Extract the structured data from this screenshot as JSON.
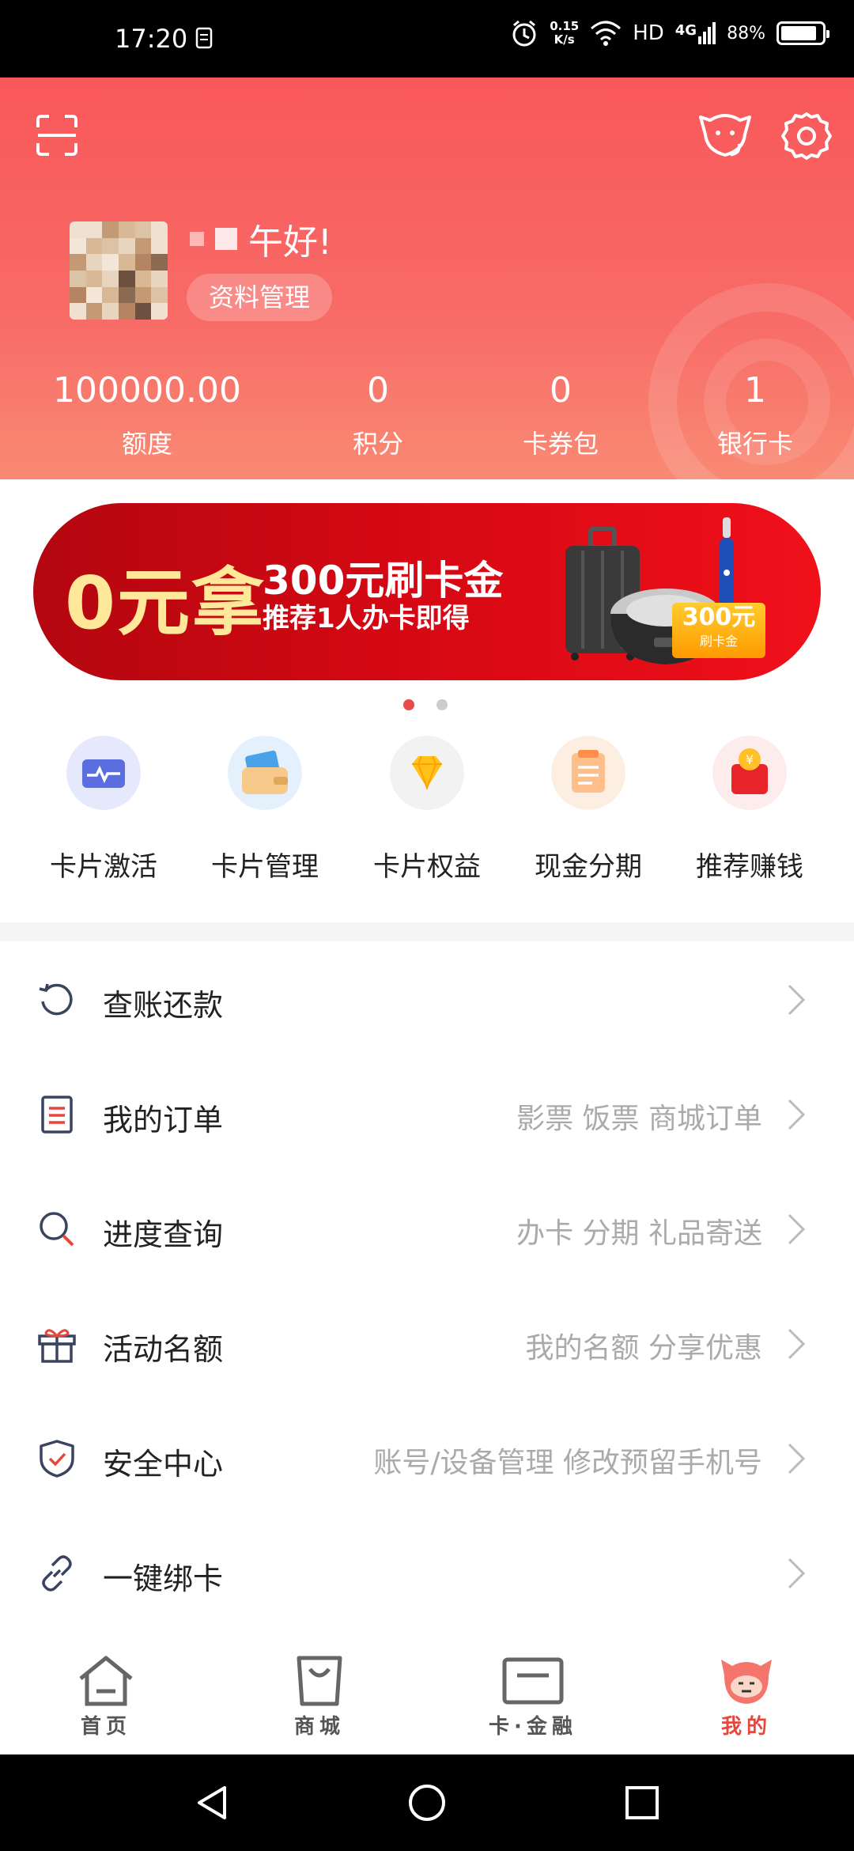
{
  "status_bar": {
    "time": "17:20",
    "speed_value": "0.15",
    "speed_unit": "K/s",
    "hd": "HD",
    "network": "4G",
    "battery": "88%",
    "battery_level": 0.88
  },
  "header": {
    "greeting": "午好!",
    "profile_button": "资料管理",
    "stats": [
      {
        "value": "100000.00",
        "label": "额度"
      },
      {
        "value": "0",
        "label": "积分"
      },
      {
        "value": "0",
        "label": "卡券包"
      },
      {
        "value": "1",
        "label": "银行卡"
      }
    ]
  },
  "banner": {
    "big_text": "0元拿",
    "line1": "300元刷卡金",
    "line2": "推荐1人办卡即得",
    "tag_amount": "300元",
    "tag_label": "刷卡金",
    "page_count": 2,
    "active_page": 1
  },
  "quick_menu": [
    {
      "label": "卡片激活",
      "icon": "card-activate-icon"
    },
    {
      "label": "卡片管理",
      "icon": "wallet-icon"
    },
    {
      "label": "卡片权益",
      "icon": "diamond-icon"
    },
    {
      "label": "现金分期",
      "icon": "document-icon"
    },
    {
      "label": "推荐赚钱",
      "icon": "red-envelope-icon"
    }
  ],
  "list": [
    {
      "title": "查账还款",
      "sub": "",
      "icon": "refresh-icon"
    },
    {
      "title": "我的订单",
      "sub": "影票 饭票 商城订单",
      "icon": "order-icon"
    },
    {
      "title": "进度查询",
      "sub": "办卡 分期 礼品寄送",
      "icon": "search-icon"
    },
    {
      "title": "活动名额",
      "sub": "我的名额 分享优惠",
      "icon": "gift-icon"
    },
    {
      "title": "安全中心",
      "sub": "账号/设备管理 修改预留手机号",
      "icon": "shield-icon"
    },
    {
      "title": "一键绑卡",
      "sub": "",
      "icon": "link-icon"
    }
  ],
  "bottom_nav": [
    {
      "label": "首页",
      "icon": "home-icon",
      "active": false
    },
    {
      "label": "商城",
      "icon": "shopping-bag-icon",
      "active": false
    },
    {
      "label": "卡·金融",
      "icon": "card-icon",
      "active": false
    },
    {
      "label": "我的",
      "icon": "mascot-icon",
      "active": true
    }
  ],
  "colors": {
    "brand_red": "#f9585a",
    "active_nav": "#e8453c",
    "banner_red": "#d40813"
  }
}
